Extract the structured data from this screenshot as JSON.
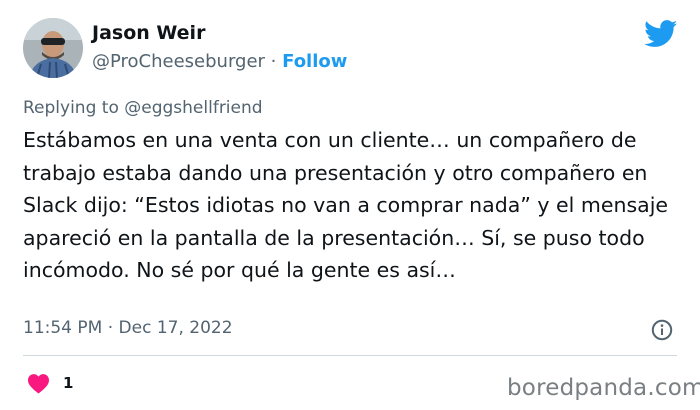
{
  "header": {
    "display_name": "Jason Weir",
    "handle": "@ProCheeseburger",
    "separator": " · ",
    "follow_label": "Follow"
  },
  "reply": {
    "prefix": "Replying to ",
    "mention": "@eggshellfriend"
  },
  "tweet": {
    "text": "Estábamos en una venta con un cliente… un compañero de trabajo estaba dando una presentación y otro compañero en Slack dijo: “Estos idiotas no van a comprar nada” y el mensaje apareció en la pantalla de la presentación… Sí, se puso todo incómodo. No sé por qué la gente es así…"
  },
  "meta": {
    "timestamp": "11:54 PM · Dec 17, 2022"
  },
  "engagement": {
    "like_count": "1"
  },
  "watermark": "boredpanda.com",
  "colors": {
    "accent": "#1d9bf0",
    "heart": "#f91880",
    "muted": "#536471",
    "text": "#0f1419"
  },
  "icons": {
    "bird": "twitter-bird-icon",
    "info": "info-icon",
    "heart": "heart-icon"
  }
}
